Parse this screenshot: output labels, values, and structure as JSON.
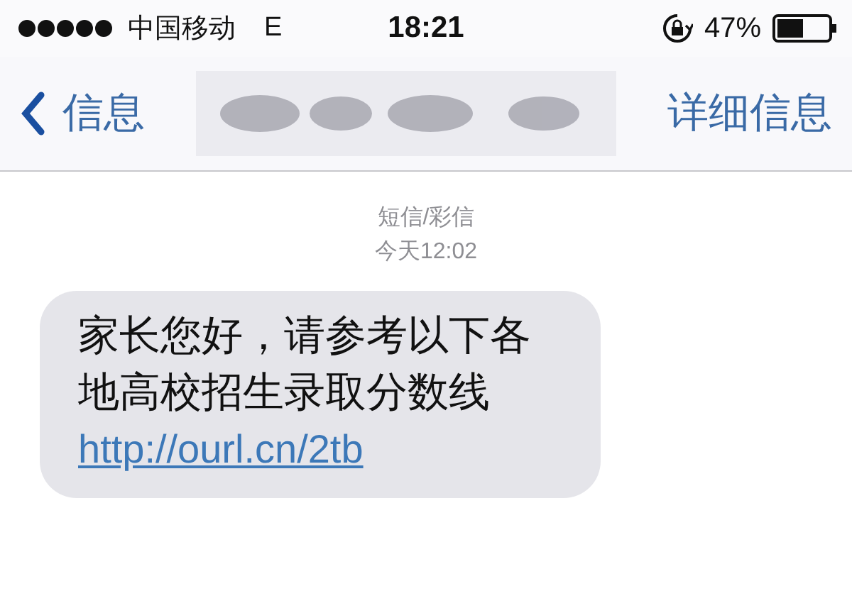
{
  "status_bar": {
    "carrier": "中国移动",
    "network": "E",
    "time": "18:21",
    "battery_text": "47%"
  },
  "nav": {
    "back": "信息",
    "action": "详细信息"
  },
  "thread": {
    "service": "短信/彩信",
    "timestamp": "今天12:02"
  },
  "messages": [
    {
      "kind": "incoming",
      "text": "家长您好，请参考以下各地高校招生录取分数线",
      "link": "http://ourl.cn/2tb"
    }
  ]
}
